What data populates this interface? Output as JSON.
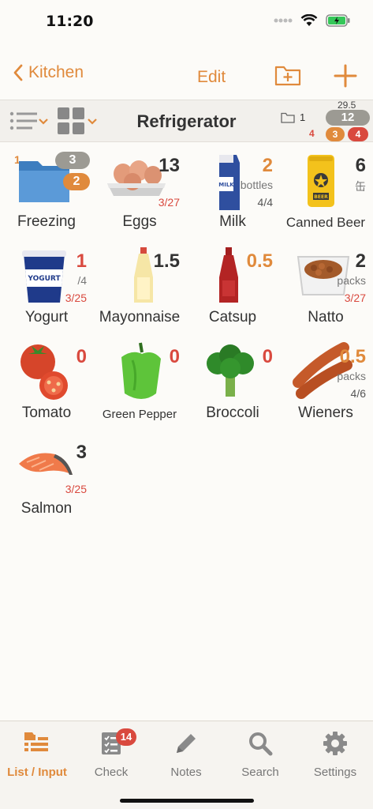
{
  "status": {
    "time": "11:20"
  },
  "nav": {
    "back_label": "Kitchen",
    "edit_label": "Edit"
  },
  "toolbar": {
    "title": "Refrigerator",
    "folder_count": "1",
    "total_top": "29.5",
    "total_badge": "12",
    "red_text": "4",
    "orange_count": "3",
    "red_count": "4"
  },
  "items": [
    {
      "name": "Freezing",
      "badge_top": "3",
      "badge_bottom": "2",
      "corner": "1"
    },
    {
      "name": "Eggs",
      "qty": "13",
      "date": "3/27"
    },
    {
      "name": "Milk",
      "qty": "2",
      "unit": "bottles",
      "sub": "4/4"
    },
    {
      "name": "Canned Beer",
      "qty": "6",
      "unit": "缶"
    },
    {
      "name": "Yogurt",
      "qty": "1",
      "unit": "/4",
      "date": "3/25"
    },
    {
      "name": "Mayonnaise",
      "qty": "1.5"
    },
    {
      "name": "Catsup",
      "qty": "0.5"
    },
    {
      "name": "Natto",
      "qty": "2",
      "unit": "packs",
      "date": "3/27"
    },
    {
      "name": "Tomato",
      "qty": "0"
    },
    {
      "name": "Green Pepper",
      "qty": "0"
    },
    {
      "name": "Broccoli",
      "qty": "0"
    },
    {
      "name": "Wieners",
      "qty": "0.5",
      "unit": "packs",
      "sub": "4/6"
    },
    {
      "name": "Salmon",
      "qty": "3",
      "date": "3/25"
    }
  ],
  "tabs": [
    {
      "label": "List / Input",
      "icon": "list-input-icon"
    },
    {
      "label": "Check",
      "icon": "checklist-icon",
      "badge": "14"
    },
    {
      "label": "Notes",
      "icon": "pencil-icon"
    },
    {
      "label": "Search",
      "icon": "search-icon"
    },
    {
      "label": "Settings",
      "icon": "gear-icon"
    }
  ],
  "colors": {
    "accent": "#e08a3c",
    "alert": "#d9493e",
    "badge_gray": "#9c9a93"
  }
}
